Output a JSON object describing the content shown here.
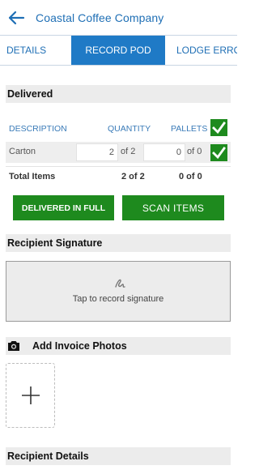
{
  "header": {
    "title": "Coastal Coffee Company",
    "back_icon": "arrow-left-icon"
  },
  "tabs": [
    {
      "label": "DETAILS",
      "active": false
    },
    {
      "label": "RECORD POD",
      "active": true
    },
    {
      "label": "LODGE ERRO",
      "active": false
    }
  ],
  "delivered": {
    "heading": "Delivered",
    "columns": {
      "description": "DESCRIPTION",
      "quantity": "QUANTITY",
      "pallets": "PALLETS"
    },
    "rows": [
      {
        "description": "Carton",
        "quantity_value": "2",
        "quantity_of": "of 2",
        "pallets_value": "0",
        "pallets_of": "of 0",
        "checked": true
      }
    ],
    "total": {
      "label": "Total Items",
      "quantity": "2 of 2",
      "pallets": "0 of 0"
    },
    "all_checked": true
  },
  "actions": {
    "delivered_in_full": "DELIVERED IN FULL",
    "scan_items": "SCAN ITEMS"
  },
  "signature": {
    "heading": "Recipient Signature",
    "prompt": "Tap to record signature",
    "icon": "signature-icon"
  },
  "photos": {
    "heading": "Add Invoice Photos",
    "icon": "camera-icon",
    "add_icon": "plus-icon"
  },
  "recipient": {
    "heading": "Recipient Details"
  },
  "colors": {
    "accent": "#1f7ac6",
    "link": "#1f6fb5",
    "action_green": "#1e8a1e",
    "check_green": "#1e8a1e",
    "section_bg": "#ececec"
  }
}
